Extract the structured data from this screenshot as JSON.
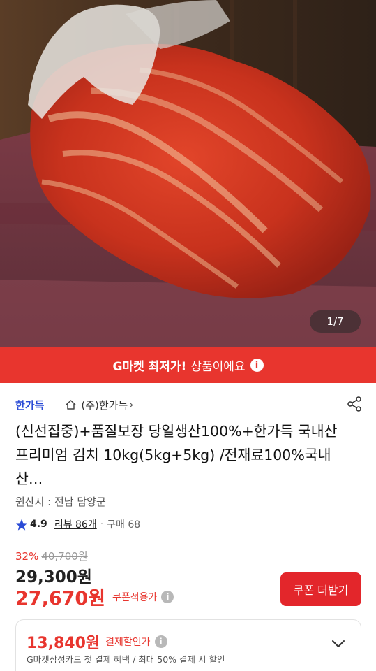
{
  "hero": {
    "image_counter": "1/7"
  },
  "banner": {
    "strong_text": "G마켓 최저가!",
    "rest_text": "상품이에요",
    "info_icon": "i"
  },
  "seller": {
    "name": "한가득",
    "store_name": "(주)한가득",
    "chevron": "›"
  },
  "product": {
    "title": "(신선집중)+품질보장 당일생산100%+한가득 국내산 프리미엄 김치 10kg(5kg+5kg) /전재료100%국내산…",
    "origin": "원산지 : 전남 담양군"
  },
  "rating": {
    "score": "4.9",
    "review": "리뷰 86개",
    "dot": "·",
    "purchase": "구매 68"
  },
  "price": {
    "discount_rate": "32%",
    "original": "40,700원",
    "sale": "29,300원",
    "coupon_price": "27,670원",
    "coupon_label": "쿠폰적용가",
    "info_icon": "i",
    "coupon_button": "쿠폰 더받기"
  },
  "card_discount": {
    "price": "13,840원",
    "label": "결제할인가",
    "info_icon": "i",
    "description": "G마켓삼성카드 첫 결제 혜택 / 최대 50% 결제 시 할인"
  },
  "colors": {
    "accent_red": "#e8352e",
    "seller_blue": "#2a4bd6",
    "star": "#2a4bd6"
  },
  "icons": [
    "home-icon",
    "share-icon",
    "star-icon",
    "info-icon",
    "chevron-down-icon"
  ]
}
